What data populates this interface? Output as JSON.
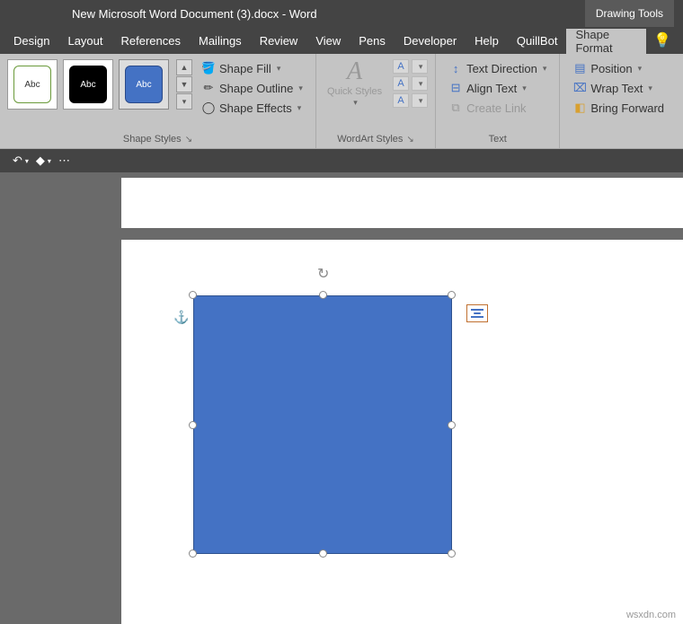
{
  "title": "New Microsoft Word Document (3).docx  -  Word",
  "contextTab": "Drawing Tools",
  "menu": [
    "Design",
    "Layout",
    "References",
    "Mailings",
    "Review",
    "View",
    "Pens",
    "Developer",
    "Help",
    "QuillBot"
  ],
  "activeTab": "Shape Format",
  "styles": {
    "thumbLabel": "Abc",
    "groupLabel": "Shape Styles",
    "fill": "Shape Fill",
    "outline": "Shape Outline",
    "effects": "Shape Effects"
  },
  "wordart": {
    "groupLabel": "WordArt Styles",
    "quick": "Quick Styles"
  },
  "text": {
    "groupLabel": "Text",
    "direction": "Text Direction",
    "align": "Align Text",
    "link": "Create Link"
  },
  "arrange": {
    "position": "Position",
    "wrap": "Wrap Text",
    "forward": "Bring Forward"
  },
  "watermark": "wsxdn.com"
}
